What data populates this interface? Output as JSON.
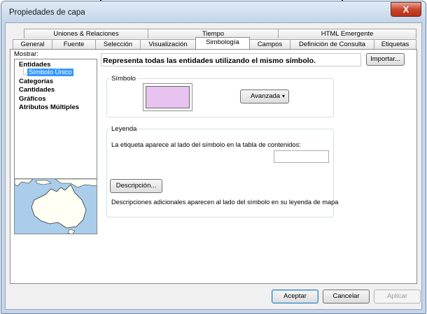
{
  "window": {
    "title": "Propiedades de capa",
    "close_label": "X"
  },
  "tabs": {
    "row1": [
      "Uniones & Relaciones",
      "Tiempo",
      "HTML Emergente"
    ],
    "row2": [
      "General",
      "Fuente",
      "Selección",
      "Visualización",
      "Simbología",
      "Campos",
      "Definición de Consulta",
      "Etiquetas"
    ],
    "active": "Simbología"
  },
  "sidebar": {
    "show_label": "Mostrar:",
    "items": [
      {
        "label": "Entidades"
      },
      {
        "label": "Símbolo Único"
      },
      {
        "label": "Categorías"
      },
      {
        "label": "Cantidades"
      },
      {
        "label": "Gráficos"
      },
      {
        "label": "Atributos Múltiples"
      }
    ]
  },
  "main": {
    "heading": "Representa todas las entidades utilizando el mismo símbolo.",
    "import_label": "Importar...",
    "symbol_group": {
      "label": "Símbolo",
      "advanced_label": "Avanzada",
      "symbol_color": "#e8c3ef"
    },
    "legend_group": {
      "label": "Leyenda",
      "toc_text": "La etiqueta aparece al lado del símbolo en la tabla de contenidos:",
      "toc_value": "",
      "description_label": "Descripción...",
      "description_text": "Descripciones adicionales aparecen al lado del símbolo en su leyenda de mapa"
    }
  },
  "footer": {
    "accept_label": "Aceptar",
    "cancel_label": "Cancelar",
    "apply_label": "Aplicar"
  },
  "colors": {
    "map_water": "#a9cdea",
    "map_land": "#fffff4",
    "selection": "#3399ff"
  }
}
